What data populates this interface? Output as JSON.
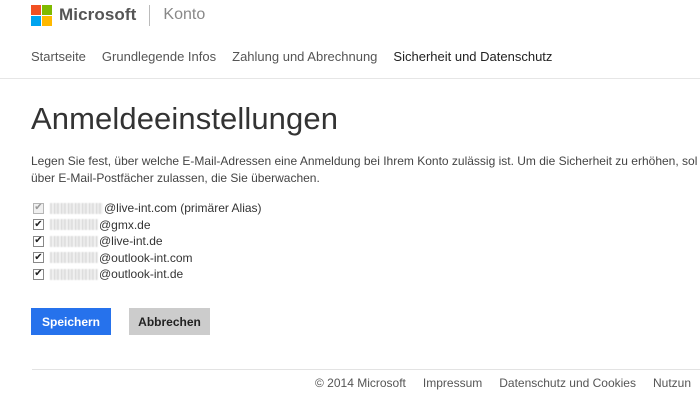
{
  "header": {
    "brand": "Microsoft",
    "product": "Konto",
    "logo_colors": [
      "#f25022",
      "#7fba00",
      "#00a4ef",
      "#ffb900"
    ]
  },
  "nav": {
    "items": [
      {
        "label": "Startseite",
        "active": false
      },
      {
        "label": "Grundlegende Infos",
        "active": false
      },
      {
        "label": "Zahlung und Abrechnung",
        "active": false
      },
      {
        "label": "Sicherheit und Datenschutz",
        "active": true
      }
    ]
  },
  "main": {
    "title": "Anmeldeeinstellungen",
    "description_line1": "Legen Sie fest, über welche E-Mail-Adressen eine Anmeldung bei Ihrem Konto zulässig ist. Um die Sicherheit zu erhöhen, sol",
    "description_line2": "über E-Mail-Postfächer zulassen, die Sie überwachen."
  },
  "aliases": [
    {
      "address": "@live-int.com (primärer Alias)",
      "checked": true,
      "disabled": true
    },
    {
      "address": "@gmx.de",
      "checked": true,
      "disabled": false
    },
    {
      "address": "@live-int.de",
      "checked": true,
      "disabled": false
    },
    {
      "address": "@outlook-int.com",
      "checked": true,
      "disabled": false
    },
    {
      "address": "@outlook-int.de",
      "checked": true,
      "disabled": false
    }
  ],
  "buttons": {
    "save_label": "Speichern",
    "cancel_label": "Abbrechen",
    "primary_color": "#2672ec"
  },
  "footer": {
    "copyright": "© 2014 Microsoft",
    "links": [
      "Impressum",
      "Datenschutz und Cookies",
      "Nutzun"
    ]
  }
}
